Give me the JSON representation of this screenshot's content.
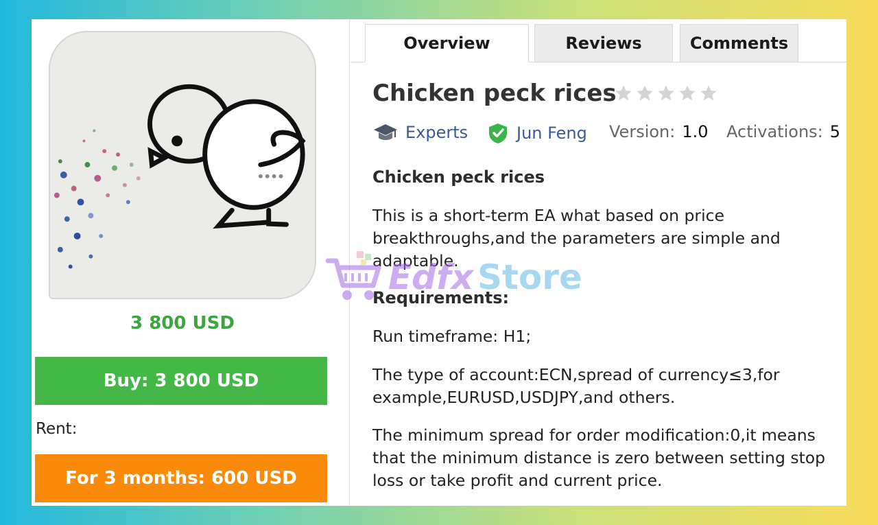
{
  "product": {
    "price": "3 800 USD",
    "buy_label": "Buy: 3 800 USD",
    "rent_label": "Rent:",
    "rent_option": "For 3 months: 600 USD"
  },
  "tabs": [
    {
      "label": "Overview",
      "active": true
    },
    {
      "label": "Reviews",
      "active": false
    },
    {
      "label": "Comments",
      "active": false
    }
  ],
  "title": "Chicken peck rices",
  "rating": {
    "stars_filled": 0,
    "stars_total": 5
  },
  "meta": {
    "category": "Experts",
    "category_icon": "graduation-cap-icon",
    "author": "Jun Feng",
    "author_icon": "verified-shield-icon",
    "version_key": "Version:",
    "version_val": "1.0",
    "activations_key": "Activations:",
    "activations_val": "5"
  },
  "description": {
    "heading": "Chicken peck rices",
    "intro": "This is a short-term EA what based on price breakthroughs,and the parameters are simple and adaptable.",
    "requirements_heading": "Requirements:",
    "timeframe": "Run timeframe: H1;",
    "account": "The type of account:ECN,spread of currency≤3,for example,EURUSD,USDJPY,and others.",
    "min_spread": "The minimum spread for order modification:0,it means that the minimum distance is zero between setting stop loss or take profit and current price."
  },
  "watermark": {
    "part1": "Edfx",
    "part2": "Store",
    "icon": "shopping-cart-icon"
  },
  "colors": {
    "price_green": "#39a83a",
    "buy_green": "#44b847",
    "rent_orange": "#f98a0a",
    "link_blue": "#3b5998",
    "star_grey": "#d4d4d4"
  }
}
